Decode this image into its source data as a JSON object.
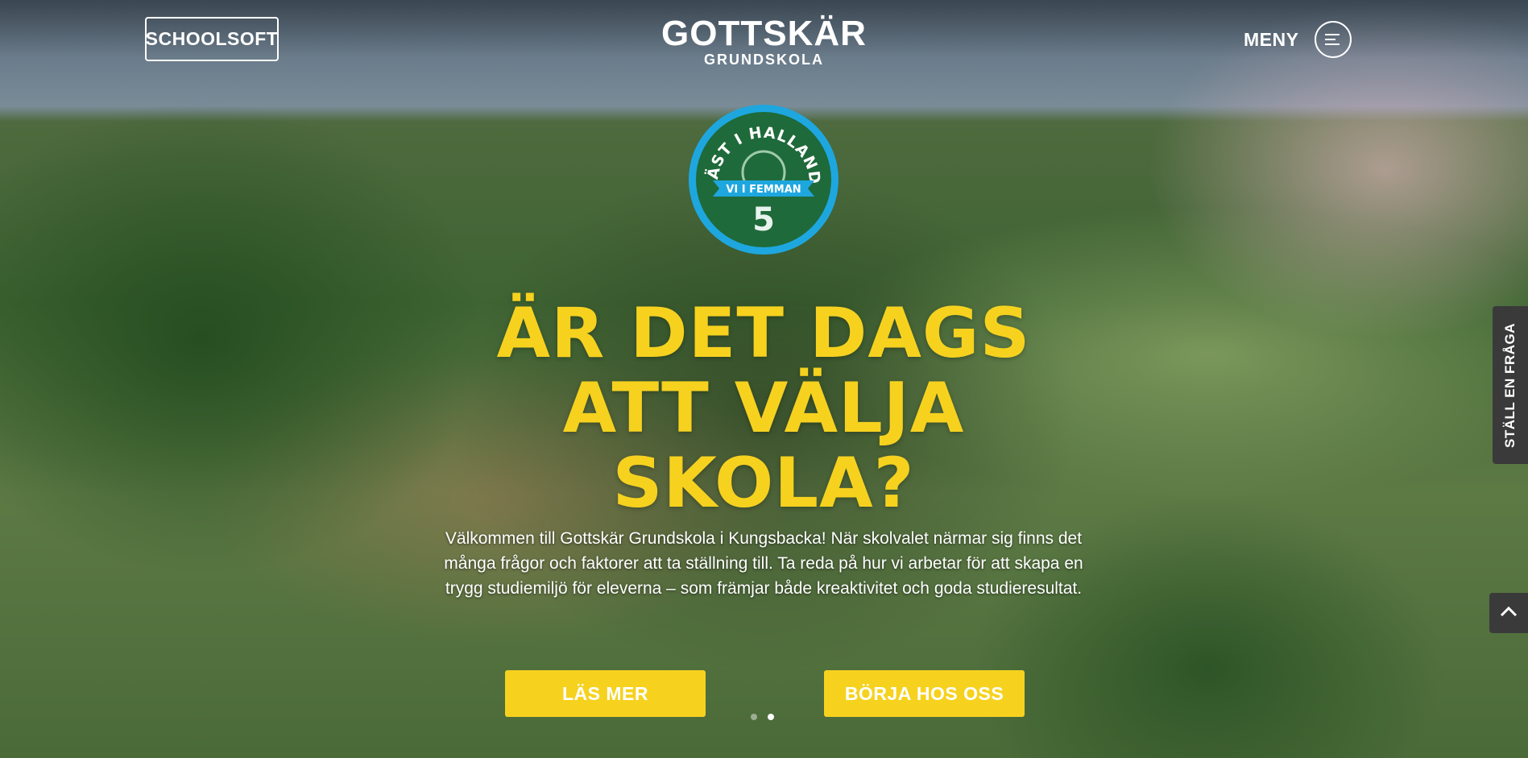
{
  "header": {
    "schoolsoft_label": "SCHOOLSOFT",
    "logo_main": "GOTTSKÄR",
    "logo_sub": "GRUNDSKOLA",
    "menu_label": "MENY"
  },
  "badge": {
    "top_text": "BÄST I HALLAND!",
    "ribbon_text": "VI I FEMMAN",
    "number": "5"
  },
  "hero": {
    "headline_lines": [
      "ÄR DET DAGS",
      "ATT VÄLJA",
      "SKOLA?"
    ],
    "intro": "Välkommen till Gottskär Grundskola i Kungsbacka! När skolvalet närmar sig finns det många frågor och faktorer att ta ställning till. Ta reda på hur vi arbetar för att skapa en trygg studiemiljö för eleverna – som främjar både kreaktivitet och goda studieresultat.",
    "cta_read_more": "LÄS MER",
    "cta_start": "BÖRJA HOS OSS"
  },
  "slider": {
    "slide_count": 2,
    "active_slide": 2
  },
  "side": {
    "ask_question_label": "STÄLL EN FRÅGA",
    "scroll_top_icon": "chevron-up-icon"
  },
  "colors": {
    "accent_yellow": "#f6d21f",
    "badge_green": "#1f6a3a",
    "badge_blue": "#1ea7df",
    "side_tab_bg": "#3a3a3a"
  }
}
